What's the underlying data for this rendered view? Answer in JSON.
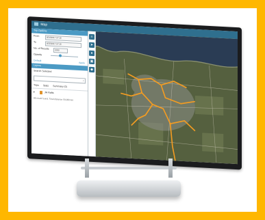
{
  "app": {
    "title": "Map"
  },
  "panel": {
    "header": "Trip Options",
    "from_label": "From",
    "from_value": "8/14/2017 07:15",
    "to_label": "To",
    "to_value": "8/15/2017 07:15",
    "results_label": "No. of Results",
    "results_value": "1000",
    "opacity_label": "Opacity",
    "default_link": "Default",
    "apply_link": "Apply",
    "layers_header": "Layers",
    "search_placeholder": "Search Selected",
    "tabs": [
      "Trips",
      "Stats",
      "Summary (0)"
    ],
    "result_title": "JH Rafts",
    "footer_text": "86 result found. Total distance 50,000 km"
  },
  "toolbar": {
    "icons": [
      "layers-icon",
      "compass-icon",
      "pin-icon",
      "car-icon",
      "stack-icon"
    ]
  },
  "colors": {
    "frame": "#ffb700",
    "accent": "#4b9ac4",
    "route": "#f39c22",
    "lake": "#2a3c54"
  }
}
